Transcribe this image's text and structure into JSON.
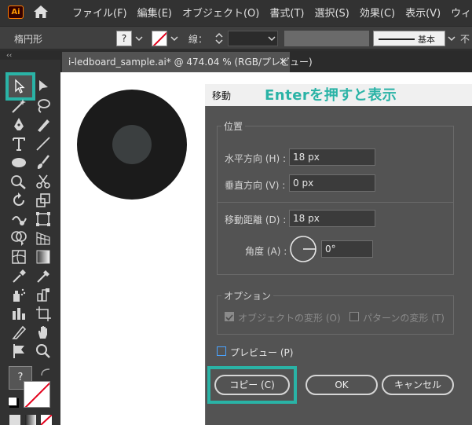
{
  "app": {
    "logo_text": "Ai",
    "menus": [
      "ファイル(F)",
      "編集(E)",
      "オブジェクト(O)",
      "書式(T)",
      "選択(S)",
      "効果(C)",
      "表示(V)",
      "ウィン"
    ]
  },
  "control_bar": {
    "shape_label": "楕円形",
    "fill_swatch": "?",
    "stroke_label": "線：",
    "style_label": "基本",
    "opacity_label": "不"
  },
  "toolbar": {
    "collapse": "‹‹",
    "fill_swatch": "?"
  },
  "document": {
    "tab_title": "i-ledboard_sample.ai* @ 474.04 % (RGB/プレビュー)",
    "close": "×"
  },
  "dialog": {
    "title": "移動",
    "annotation": "Enterを押すと表示",
    "position_group": "位置",
    "horizontal_label": "水平方向 (H) :",
    "horizontal_value": "18 px",
    "vertical_label": "垂直方向 (V) :",
    "vertical_value": "0 px",
    "distance_label": "移動距離 (D) :",
    "distance_value": "18 px",
    "angle_label": "角度 (A) :",
    "angle_value": "0°",
    "options_group": "オプション",
    "transform_objects": "オブジェクトの変形 (O)",
    "transform_patterns": "パターンの変形 (T)",
    "preview": "プレビュー (P)",
    "copy_button": "コピー (C)",
    "ok_button": "OK",
    "cancel_button": "キャンセル"
  },
  "colors": {
    "accent": "#2ab3a6",
    "dialog_bg": "#535353",
    "circle_outer": "#1b1b1b",
    "circle_inner": "#3b3f40"
  }
}
